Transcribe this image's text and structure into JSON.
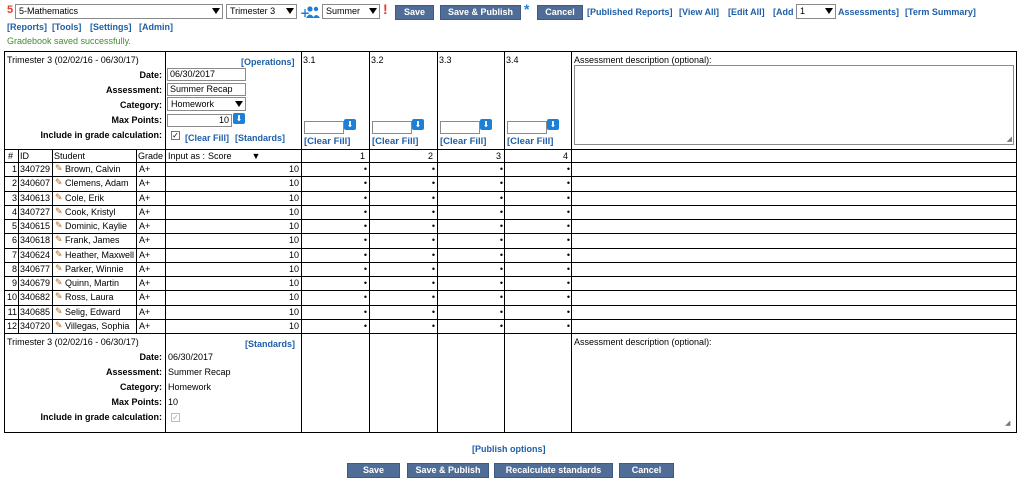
{
  "toolbar": {
    "grade_number": "5",
    "class_select": "5-Mathematics",
    "term_select": "Trimester 3",
    "group_select": "Summer",
    "save": "Save",
    "save_publish": "Save & Publish",
    "cancel": "Cancel",
    "published_reports": "[Published Reports]",
    "view_all": "[View All]",
    "edit_all": "[Edit All]",
    "add": "[Add",
    "add_count": "1",
    "assessments": "Assessments]",
    "term_summary": "[Term Summary]",
    "reports": "[Reports]",
    "tools": "[Tools]",
    "settings": "[Settings]",
    "admin": "[Admin]",
    "status_message": "Gradebook saved successfully."
  },
  "top_panel": {
    "term_label": "Trimester 3 (02/02/16 - 06/30/17)",
    "operations": "[Operations]",
    "date_label": "Date:",
    "date_value": "06/30/2017",
    "assessment_label": "Assessment:",
    "assessment_value": "Summer Recap",
    "category_label": "Category:",
    "category_value": "Homework",
    "max_points_label": "Max Points:",
    "max_points_value": "10",
    "include_label": "Include in grade calculation:",
    "clear_fill": "[Clear Fill]",
    "standards": "[Standards]",
    "desc_label": "Assessment description (optional):"
  },
  "standards_cols": [
    {
      "code": "3.1",
      "index": "1",
      "clear_fill": "[Clear Fill]"
    },
    {
      "code": "3.2",
      "index": "2",
      "clear_fill": "[Clear Fill]"
    },
    {
      "code": "3.3",
      "index": "3",
      "clear_fill": "[Clear Fill]"
    },
    {
      "code": "3.4",
      "index": "4",
      "clear_fill": "[Clear Fill]"
    }
  ],
  "table": {
    "headers": {
      "num": "#",
      "id": "ID",
      "student": "Student",
      "grade": "Grade",
      "input_as": "Input as :",
      "input_mode": "Score"
    },
    "rows": [
      {
        "num": "1",
        "id": "340729",
        "name": "Brown, Calvin",
        "grade": "A+",
        "score": "10"
      },
      {
        "num": "2",
        "id": "340607",
        "name": "Clemens, Adam",
        "grade": "A+",
        "score": "10"
      },
      {
        "num": "3",
        "id": "340613",
        "name": "Cole, Erik",
        "grade": "A+",
        "score": "10"
      },
      {
        "num": "4",
        "id": "340727",
        "name": "Cook, Kristyl",
        "grade": "A+",
        "score": "10"
      },
      {
        "num": "5",
        "id": "340615",
        "name": "Dominic, Kaylie",
        "grade": "A+",
        "score": "10"
      },
      {
        "num": "6",
        "id": "340618",
        "name": "Frank, James",
        "grade": "A+",
        "score": "10"
      },
      {
        "num": "7",
        "id": "340624",
        "name": "Heather, Maxwell",
        "grade": "A+",
        "score": "10"
      },
      {
        "num": "8",
        "id": "340677",
        "name": "Parker, Winnie",
        "grade": "A+",
        "score": "10"
      },
      {
        "num": "9",
        "id": "340679",
        "name": "Quinn, Martin",
        "grade": "A+",
        "score": "10"
      },
      {
        "num": "10",
        "id": "340682",
        "name": "Ross, Laura",
        "grade": "A+",
        "score": "10"
      },
      {
        "num": "11",
        "id": "340685",
        "name": "Selig, Edward",
        "grade": "A+",
        "score": "10"
      },
      {
        "num": "12",
        "id": "340720",
        "name": "Villegas, Sophia",
        "grade": "A+",
        "score": "10"
      }
    ],
    "standard_mark": "•"
  },
  "bottom_panel": {
    "term_label": "Trimester 3 (02/02/16 - 06/30/17)",
    "standards": "[Standards]",
    "date_label": "Date:",
    "date_value": "06/30/2017",
    "assessment_label": "Assessment:",
    "assessment_value": "Summer Recap",
    "category_label": "Category:",
    "category_value": "Homework",
    "max_points_label": "Max Points:",
    "max_points_value": "10",
    "include_label": "Include in grade calculation:",
    "desc_label": "Assessment description (optional):"
  },
  "footer": {
    "publish_options": "[Publish options]",
    "save": "Save",
    "save_publish": "Save & Publish",
    "recalculate": "Recalculate standards",
    "cancel": "Cancel"
  },
  "colors": {
    "button": "#4f6d97",
    "link": "#1f5fa8",
    "success": "#3e8e2c",
    "alert": "#e53b2c",
    "icon_blue": "#1e7fd6"
  },
  "icons": [
    "exclamation-icon",
    "group-add-icon",
    "asterisk-icon",
    "pencil-icon",
    "download-arrow-icon",
    "checkbox-icon",
    "resize-grip-icon"
  ]
}
